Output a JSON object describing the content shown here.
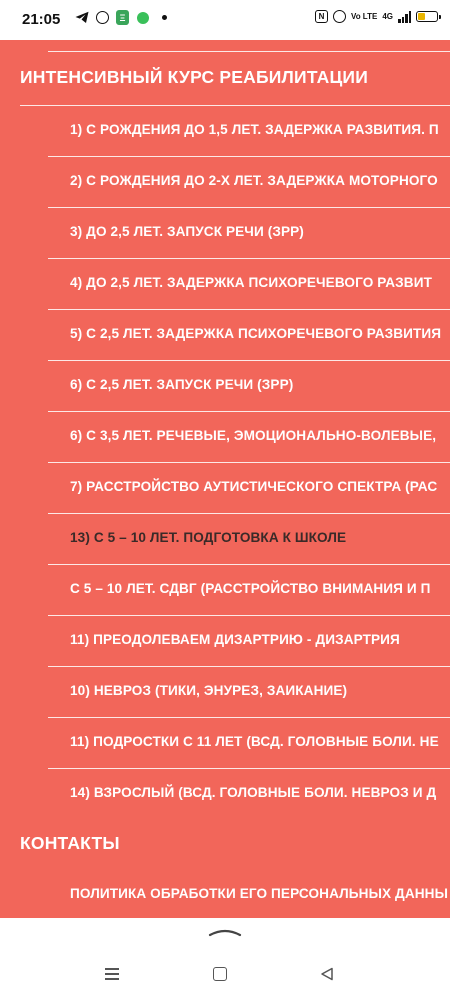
{
  "status_bar": {
    "time": "21:05",
    "left_icons": [
      "telegram-icon",
      "whatsapp-icon",
      "app-icon",
      "message-icon",
      "dot-icon"
    ],
    "right_icons": [
      "nfc-icon",
      "alarm-icon",
      "volte-icon",
      "signal-4g-icon",
      "battery-icon"
    ],
    "network": "4G",
    "volte": "Vo LTE",
    "nfc": "N",
    "battery_color": "#e9b500"
  },
  "menu": {
    "background_color": "#f2665a",
    "section_rehab": "ИНТЕНСИВНЫЙ КУРС РЕАБИЛИТАЦИИ",
    "items": [
      "1) С РОЖДЕНИЯ ДО 1,5 ЛЕТ. ЗАДЕРЖКА РАЗВИТИЯ. П",
      "2) С РОЖДЕНИЯ ДО 2-Х ЛЕТ. ЗАДЕРЖКА МОТОРНОГО",
      "3) ДО 2,5 ЛЕТ. ЗАПУСК РЕЧИ (ЗРР)",
      "4) ДО 2,5 ЛЕТ. ЗАДЕРЖКА ПСИХОРЕЧЕВОГО РАЗВИТ",
      "5) С 2,5 ЛЕТ. ЗАДЕРЖКА ПСИХОРЕЧЕВОГО РАЗВИТИЯ",
      "6) С 2,5 ЛЕТ. ЗАПУСК РЕЧИ (ЗРР)",
      "6) С 3,5 ЛЕТ. РЕЧЕВЫЕ, ЭМОЦИОНАЛЬНО-ВОЛЕВЫЕ,",
      "7) РАССТРОЙСТВО АУТИСТИЧЕСКОГО СПЕКТРА (РАС",
      "13) С 5 – 10 ЛЕТ. ПОДГОТОВКА К ШКОЛЕ",
      "С 5 – 10 ЛЕТ. СДВГ (РАССТРОЙСТВО ВНИМАНИЯ И П",
      "11) ПРЕОДОЛЕВАЕМ ДИЗАРТРИЮ - ДИЗАРТРИЯ",
      "10) НЕВРОЗ (ТИКИ, ЭНУРЕЗ, ЗАИКАНИЕ)",
      "11) ПОДРОСТКИ С 11 ЛЕТ (ВСД. ГОЛОВНЫЕ БОЛИ. НЕ",
      "14) ВЗРОСЛЫЙ (ВСД. ГОЛОВНЫЕ БОЛИ. НЕВРОЗ И Д"
    ],
    "section_contacts": "КОНТАКТЫ",
    "contacts_items": [
      "ПОЛИТИКА ОБРАБОТКИ ЕГО ПЕРСОНАЛЬНЫХ ДАННЫ"
    ],
    "active_item_index": 8
  },
  "nav_bar": {
    "icons": [
      "swipe-up-handle-icon",
      "menu-icon",
      "home-icon",
      "back-icon"
    ]
  }
}
